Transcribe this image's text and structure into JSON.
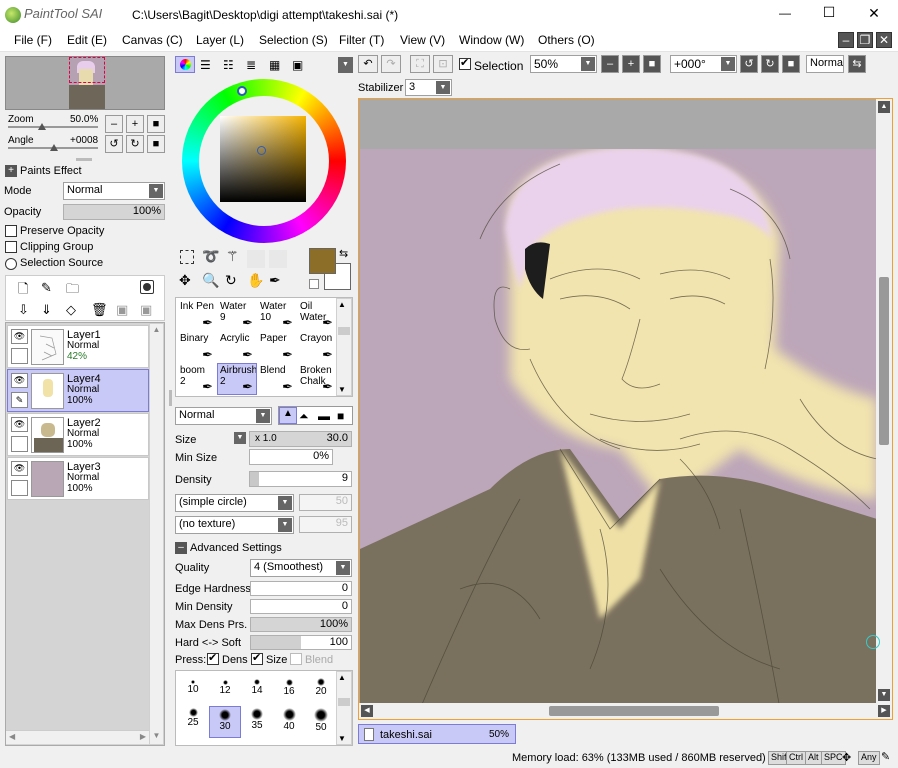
{
  "app": {
    "brand": "PaintTool SAI",
    "title": "C:\\Users\\Bagit\\Desktop\\digi attempt\\takeshi.sai (*)"
  },
  "window_controls": {
    "minimize": "—",
    "maximize": "☐",
    "close": "✕"
  },
  "menu": [
    "File (F)",
    "Edit (E)",
    "Canvas (C)",
    "Layer (L)",
    "Selection (S)",
    "Filter (T)",
    "View (V)",
    "Window (W)",
    "Others (O)"
  ],
  "navigator": {
    "zoom_label": "Zoom",
    "zoom_value": "50.0%",
    "angle_label": "Angle",
    "angle_value": "+0008"
  },
  "layer_panel": {
    "paints_effect": "Paints Effect",
    "mode_label": "Mode",
    "mode_value": "Normal",
    "opacity_label": "Opacity",
    "opacity_value": "100%",
    "opacity_level": 1.0,
    "preserve_opacity": "Preserve Opacity",
    "clipping_group": "Clipping Group",
    "selection_source": "Selection Source",
    "layers": [
      {
        "name": "Layer1",
        "mode": "Normal",
        "opacity": "42%"
      },
      {
        "name": "Layer4",
        "mode": "Normal",
        "opacity": "100%"
      },
      {
        "name": "Layer2",
        "mode": "Normal",
        "opacity": "100%"
      },
      {
        "name": "Layer3",
        "mode": "Normal",
        "opacity": "100%"
      }
    ]
  },
  "color": {
    "primary": "#8d6e28",
    "secondary": "#ffffff",
    "wheel_marker": "#2d5cb8"
  },
  "tools": [
    {
      "name": "Ink Pen",
      "size": ""
    },
    {
      "name": "Water",
      "size": "9"
    },
    {
      "name": "Water",
      "size": "10"
    },
    {
      "name": "Oil Water",
      "size": ""
    },
    {
      "name": "Binary",
      "size": ""
    },
    {
      "name": "Acrylic",
      "size": ""
    },
    {
      "name": "Paper",
      "size": ""
    },
    {
      "name": "Crayon",
      "size": ""
    },
    {
      "name": "boom",
      "size": "2"
    },
    {
      "name": "Airbrush",
      "size": "2"
    },
    {
      "name": "Blend",
      "size": ""
    },
    {
      "name": "Broken Chalk",
      "size": ""
    }
  ],
  "brush": {
    "blend_mode": "Normal",
    "size_label": "Size",
    "size_mult": "x 1.0",
    "size_value": "30.0",
    "min_size_label": "Min Size",
    "min_size_value": "0%",
    "density_label": "Density",
    "density_value": "9",
    "shape": "(simple circle)",
    "shape_value": "50",
    "texture": "(no texture)",
    "texture_value": "95",
    "advanced": "Advanced Settings",
    "quality_label": "Quality",
    "quality_value": "4 (Smoothest)",
    "edge_label": "Edge Hardness",
    "edge_value": "0",
    "mindens_label": "Min Density",
    "mindens_value": "0",
    "maxdens_label": "Max Dens Prs.",
    "maxdens_value": "100%",
    "hardsoft_label": "Hard <-> Soft",
    "hardsoft_value": "100",
    "press_label": "Press:",
    "press_dens": "Dens",
    "press_size": "Size",
    "press_blend": "Blend",
    "presets_row1": [
      "10",
      "12",
      "14",
      "16",
      "20"
    ],
    "presets_row2": [
      "25",
      "30",
      "35",
      "40",
      "50"
    ]
  },
  "toolbar": {
    "selection_label": "Selection",
    "zoom_value": "50%",
    "angle_value": "+000°",
    "mode_value": "Normal",
    "stabilizer_label": "Stabilizer",
    "stabilizer_value": "3"
  },
  "document_tab": {
    "name": "takeshi.sai",
    "zoom": "50%"
  },
  "status": {
    "memory": "Memory load: 63% (133MB used / 860MB reserved)",
    "keys": [
      "Shift",
      "Ctrl",
      "Alt",
      "SPC",
      "Any"
    ]
  }
}
